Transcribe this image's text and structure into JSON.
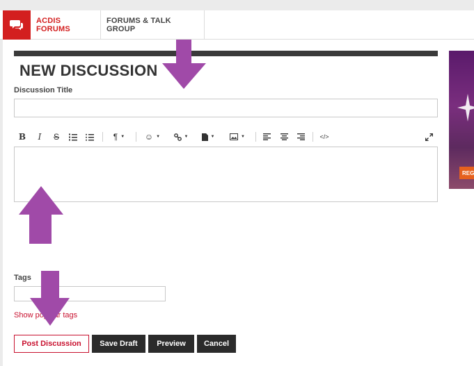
{
  "nav": {
    "brand_icon": "chat-bubbles-icon",
    "tabs": [
      {
        "label": "ACDIS FORUMS",
        "active": true
      },
      {
        "label": "FORUMS & TALK GROUP",
        "active": false
      }
    ]
  },
  "form": {
    "heading": "NEW DISCUSSION",
    "title_label": "Discussion Title",
    "title_value": "",
    "body_value": "",
    "tags_label": "Tags",
    "tags_value": "",
    "popular_tags_link": "Show popular tags"
  },
  "toolbar": {
    "items": [
      "bold-icon",
      "italic-icon",
      "strikethrough-icon",
      "ordered-list-icon",
      "bullet-list-icon",
      "paragraph-format-icon",
      "emoji-icon",
      "link-icon",
      "file-icon",
      "image-icon",
      "align-left-icon",
      "align-center-icon",
      "align-right-icon",
      "code-view-icon",
      "fullscreen-icon"
    ]
  },
  "buttons": {
    "post": "Post Discussion",
    "save_draft": "Save Draft",
    "preview": "Preview",
    "cancel": "Cancel"
  },
  "ad": {
    "badge_text": "REGI"
  },
  "colors": {
    "brand_red": "#d31f1f",
    "link_red": "#c8102e",
    "dark_button": "#2b2b2b",
    "annotation_arrow": "#a04aa8"
  }
}
